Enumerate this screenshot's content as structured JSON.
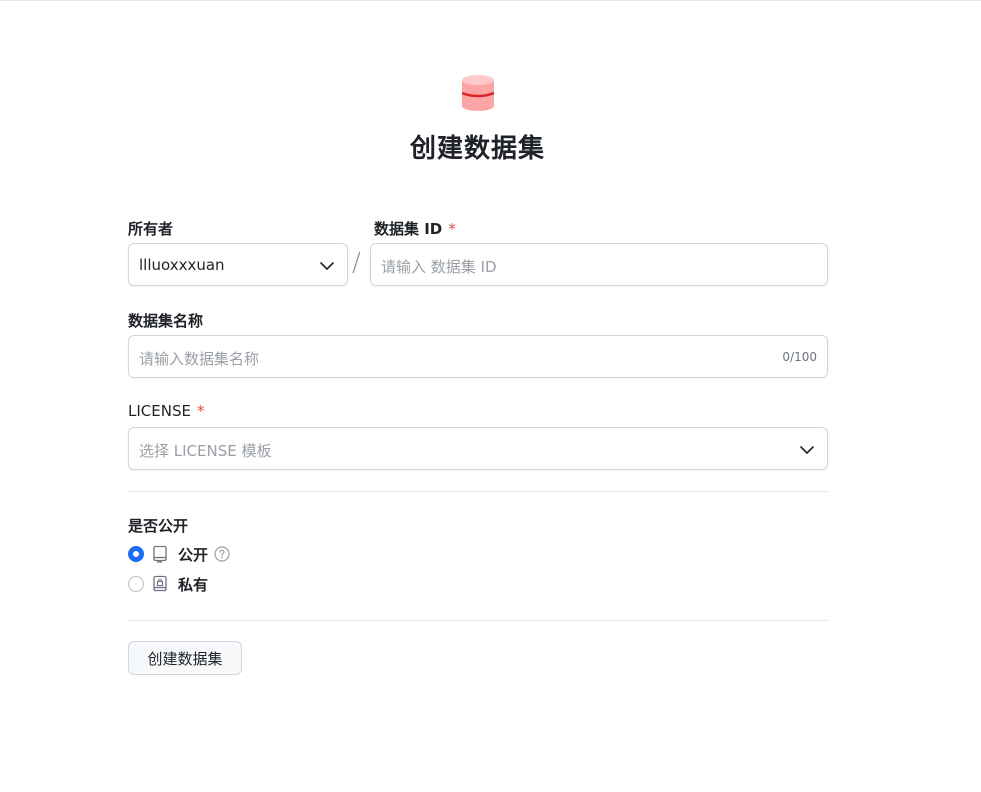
{
  "page": {
    "title": "创建数据集"
  },
  "owner": {
    "label": "所有者",
    "value": "llluoxxxuan",
    "icon": "chevron-down-icon"
  },
  "separator": "/",
  "dataset_id": {
    "label": "数据集 ID",
    "required_mark": "*",
    "placeholder": "请输入 数据集 ID"
  },
  "dataset_name": {
    "label": "数据集名称",
    "placeholder": "请输入数据集名称",
    "counter": "0/100"
  },
  "license": {
    "label": "LICENSE",
    "required_mark": "*",
    "placeholder": "选择 LICENSE 模板",
    "icon": "chevron-down-icon"
  },
  "visibility": {
    "label": "是否公开",
    "options": [
      {
        "label": "公开",
        "selected": true,
        "icon": "repo-icon",
        "help_icon": "question-circle-icon"
      },
      {
        "label": "私有",
        "selected": false,
        "icon": "lock-repo-icon"
      }
    ]
  },
  "submit": {
    "label": "创建数据集"
  },
  "colors": {
    "accent": "#1d6cf5",
    "required": "#e5484d",
    "logo": "#f87171"
  }
}
